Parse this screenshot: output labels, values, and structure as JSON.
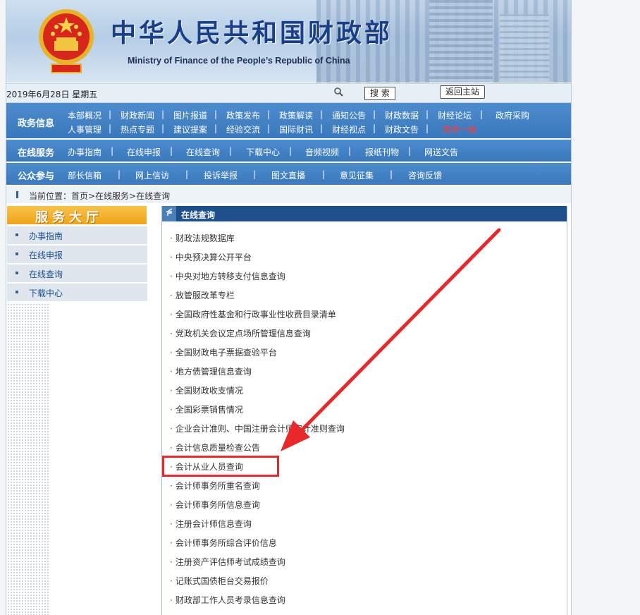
{
  "header": {
    "title": "中华人民共和国财政部",
    "subtitle": "Ministry of Finance of the People’s Republic of China"
  },
  "datebar": {
    "date": "2019年6月28日 星期五",
    "search_label": "搜 索",
    "home_label": "返回主站"
  },
  "nav": {
    "row1": {
      "label": "政务信息",
      "line1": [
        "本部概况",
        "财政新闻",
        "图片报道",
        "政策发布",
        "政策解读",
        "通知公告",
        "财政数据",
        "财经论坛",
        "政府采购"
      ],
      "line2": [
        "人事管理",
        "热点专题",
        "建议提案",
        "经验交流",
        "国际财讯",
        "财经视点",
        "财政文告",
        "两学一做"
      ]
    },
    "row2": {
      "label": "在线服务",
      "items": [
        "办事指南",
        "在线申报",
        "在线查询",
        "下载中心",
        "音频视频",
        "报纸刊物",
        "网送文告"
      ]
    },
    "row3": {
      "label": "公众参与",
      "items": [
        "部长信箱",
        "网上信访",
        "投诉举报",
        "图文直播",
        "意见征集",
        "咨询反馈"
      ]
    }
  },
  "breadcrumb": "当前位置：首页>在线服务>在线查询",
  "sidebar": {
    "title": "服务大厅",
    "items": [
      "办事指南",
      "在线申报",
      "在线查询",
      "下载中心"
    ]
  },
  "main": {
    "title": "在线查询",
    "links": [
      "财政法规数据库",
      "中央预决算公开平台",
      "中央对地方转移支付信息查询",
      "放管服改革专栏",
      "全国政府性基金和行政事业性收费目录清单",
      "党政机关会议定点场所管理信息查询",
      "全国财政电子票据查验平台",
      "地方债管理信息查询",
      "全国财政收支情况",
      "全国彩票销售情况",
      "企业会计准则、中国注册会计师审计准则查询",
      "会计信息质量检查公告",
      "会计从业人员查询",
      "会计师事务所重名查询",
      "会计师事务所信息查询",
      "注册会计师信息查询",
      "会计师事务所综合评价信息",
      "注册资产评估师考试成绩查询",
      "记账式国债柜台交易报价",
      "财政部工作人员考录信息查询"
    ],
    "bullet": "·"
  },
  "colors": {
    "nav_blue": "#3a78bd",
    "highlight_red": "#e8282b",
    "special_link": "#ff3b3b"
  }
}
